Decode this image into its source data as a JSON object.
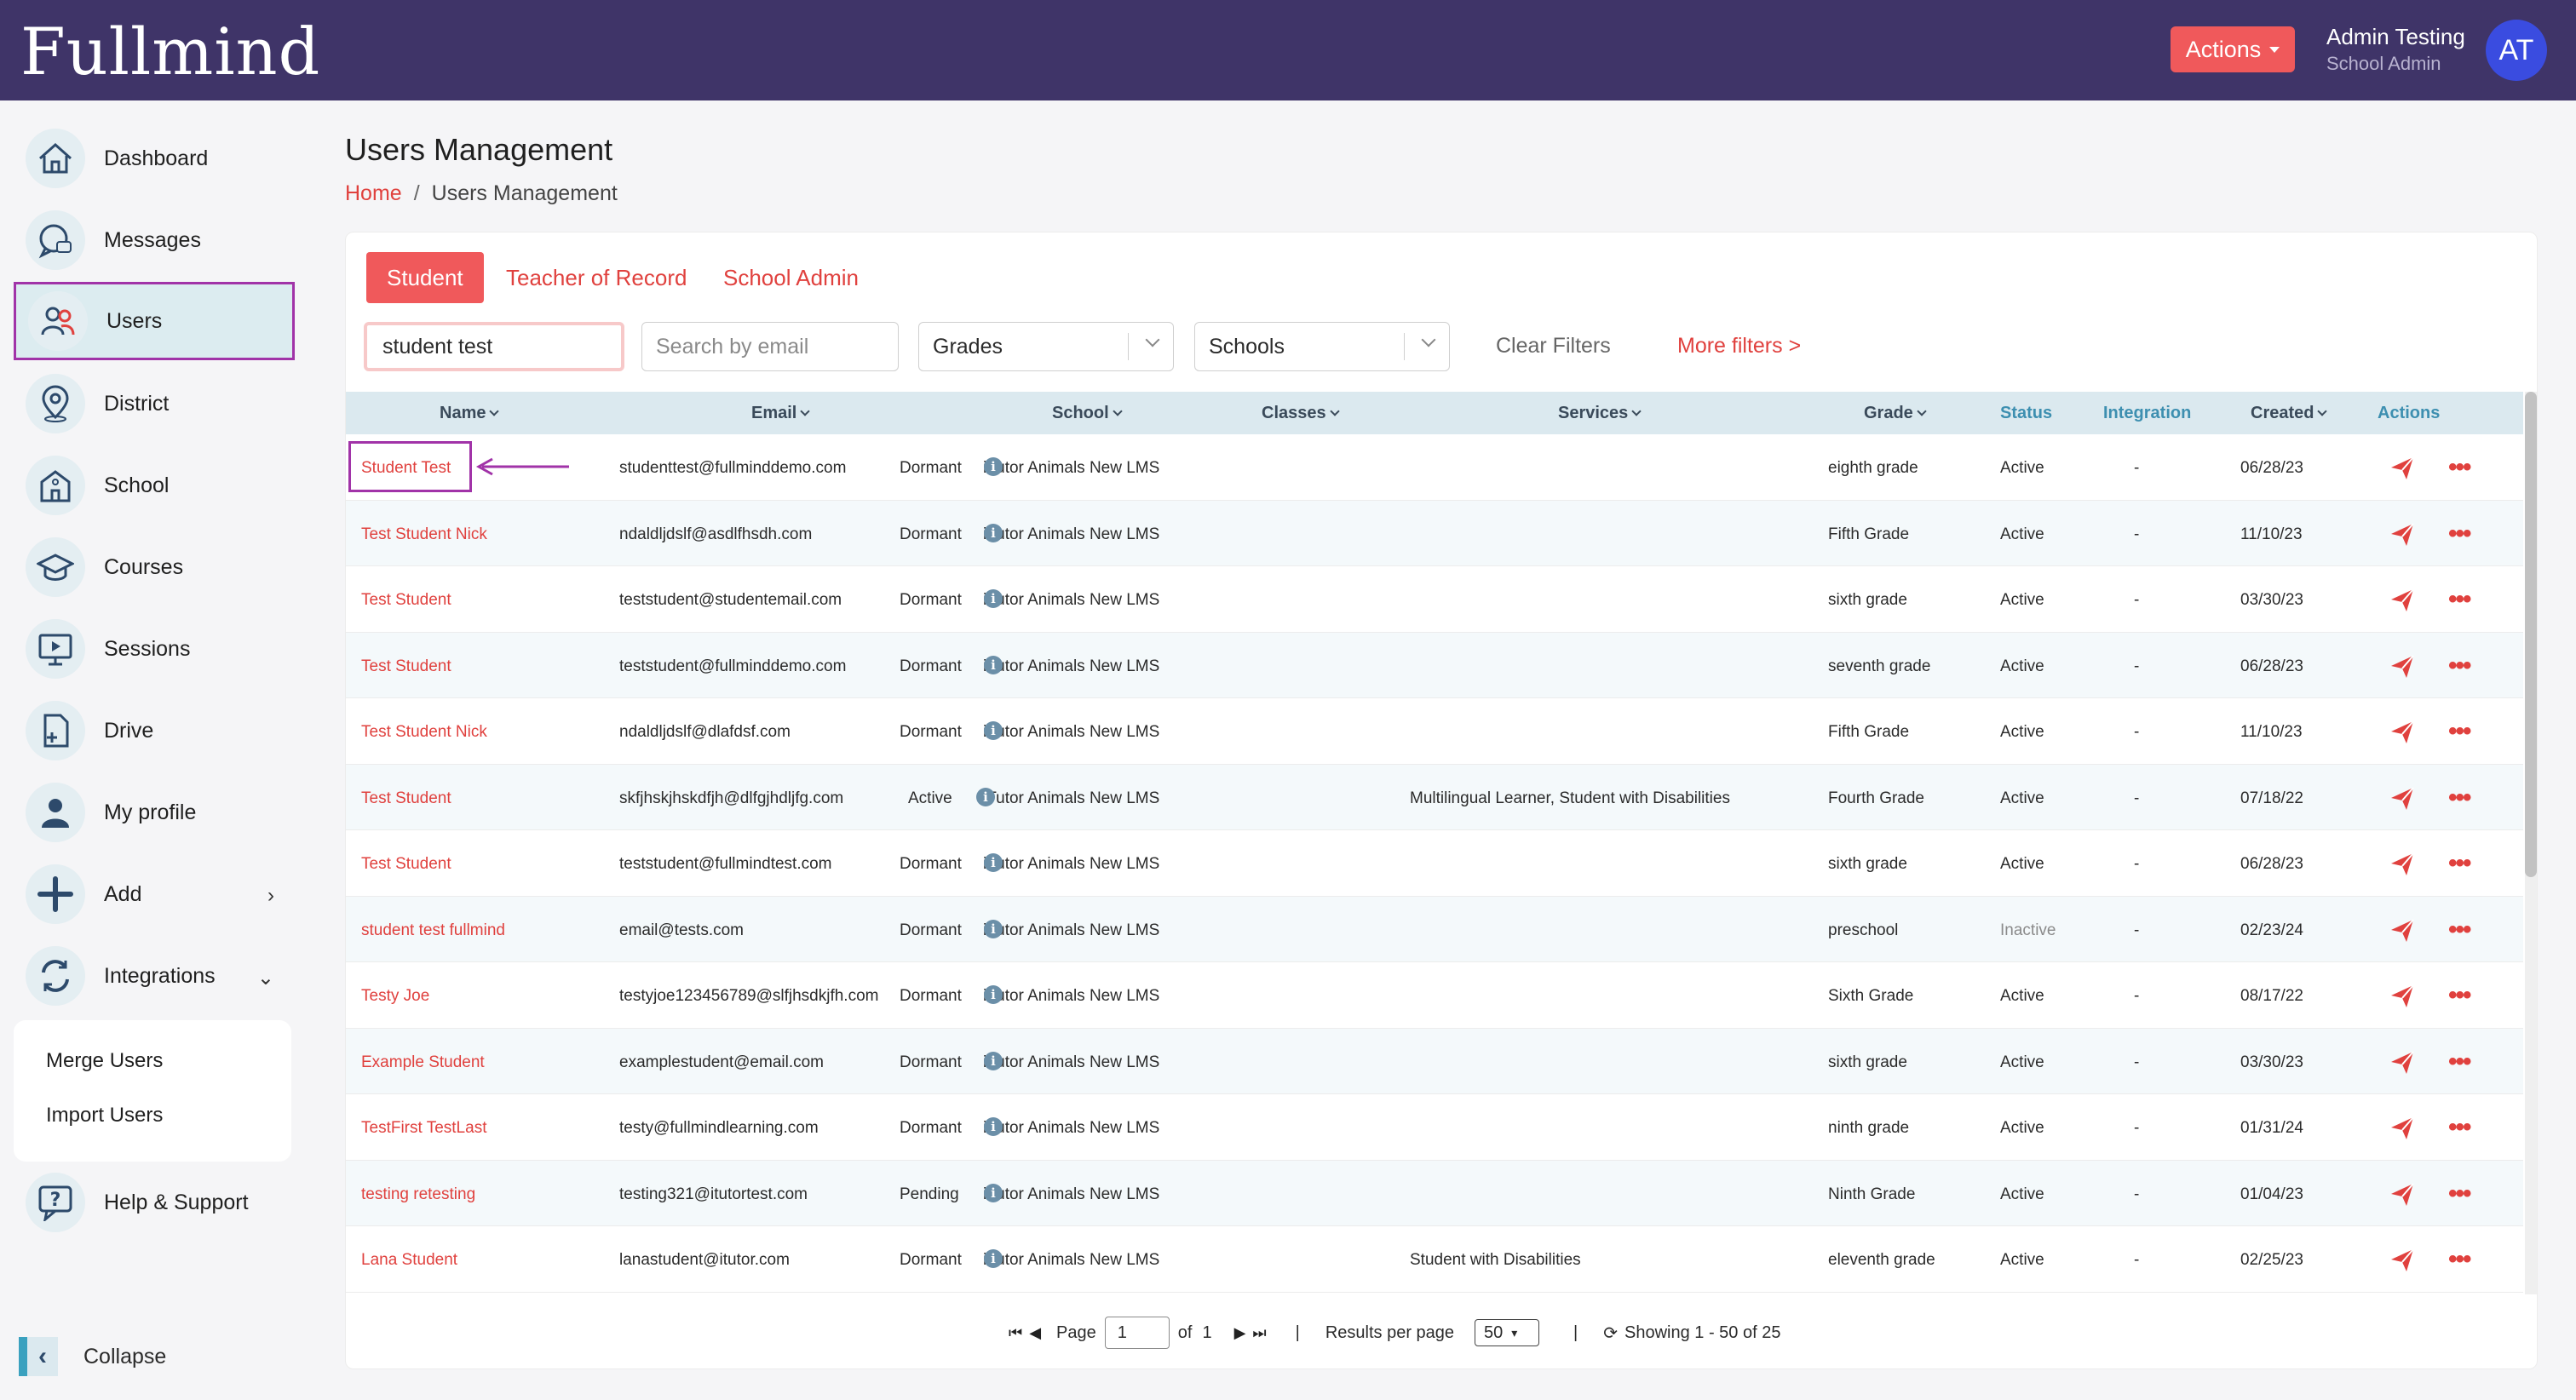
{
  "header": {
    "logo": "Fullmind",
    "actions_label": "Actions",
    "user_name": "Admin Testing",
    "user_role": "School Admin",
    "avatar_initials": "AT"
  },
  "sidebar": {
    "items": [
      {
        "label": "Dashboard",
        "icon": "home-icon"
      },
      {
        "label": "Messages",
        "icon": "chat-icon"
      },
      {
        "label": "Users",
        "icon": "users-icon"
      },
      {
        "label": "District",
        "icon": "location-pin-icon"
      },
      {
        "label": "School",
        "icon": "school-icon"
      },
      {
        "label": "Courses",
        "icon": "graduation-cap-icon"
      },
      {
        "label": "Sessions",
        "icon": "monitor-play-icon"
      },
      {
        "label": "Drive",
        "icon": "file-add-icon"
      },
      {
        "label": "My profile",
        "icon": "person-icon"
      },
      {
        "label": "Add",
        "icon": "plus-icon"
      },
      {
        "label": "Integrations",
        "icon": "sync-icon"
      }
    ],
    "submenu": [
      "Merge Users",
      "Import Users"
    ],
    "help_label": "Help & Support",
    "collapse_label": "Collapse"
  },
  "main": {
    "title": "Users Management",
    "breadcrumb_home": "Home",
    "breadcrumb_sep": "/",
    "breadcrumb_current": "Users Management",
    "tabs": [
      "Student",
      "Teacher of Record",
      "School Admin"
    ],
    "filters": {
      "name_value": "student test",
      "email_placeholder": "Search by email",
      "grades_label": "Grades",
      "schools_label": "Schools",
      "clear_label": "Clear Filters",
      "more_label": "More filters >"
    },
    "columns": [
      "Name",
      "Email",
      "School",
      "Classes",
      "Services",
      "Grade",
      "Status",
      "Integration",
      "Created",
      "Actions"
    ],
    "rows": [
      {
        "name": "Student Test",
        "email": "studenttest@fullminddemo.com",
        "school": "iTutor Animals New LMS",
        "classes": "Dormant",
        "services": "",
        "grade": "eighth grade",
        "status": "Active",
        "integration": "-",
        "created": "06/28/23"
      },
      {
        "name": "Test Student Nick",
        "email": "ndaldljdslf@asdlfhsdh.com",
        "school": "iTutor Animals New LMS",
        "classes": "Dormant",
        "services": "",
        "grade": "Fifth Grade",
        "status": "Active",
        "integration": "-",
        "created": "11/10/23"
      },
      {
        "name": "Test Student",
        "email": "teststudent@studentemail.com",
        "school": "iTutor Animals New LMS",
        "classes": "Dormant",
        "services": "",
        "grade": "sixth grade",
        "status": "Active",
        "integration": "-",
        "created": "03/30/23"
      },
      {
        "name": "Test Student",
        "email": "teststudent@fullminddemo.com",
        "school": "iTutor Animals New LMS",
        "classes": "Dormant",
        "services": "",
        "grade": "seventh grade",
        "status": "Active",
        "integration": "-",
        "created": "06/28/23"
      },
      {
        "name": "Test Student Nick",
        "email": "ndaldljdslf@dlafdsf.com",
        "school": "iTutor Animals New LMS",
        "classes": "Dormant",
        "services": "",
        "grade": "Fifth Grade",
        "status": "Active",
        "integration": "-",
        "created": "11/10/23"
      },
      {
        "name": "Test Student",
        "email": "skfjhskjhskdfjh@dlfgjhdljfg.com",
        "school": "iTutor Animals New LMS",
        "classes": "Active",
        "services": "Multilingual Learner, Student with Disabilities",
        "grade": "Fourth Grade",
        "status": "Active",
        "integration": "-",
        "created": "07/18/22"
      },
      {
        "name": "Test Student",
        "email": "teststudent@fullmindtest.com",
        "school": "iTutor Animals New LMS",
        "classes": "Dormant",
        "services": "",
        "grade": "sixth grade",
        "status": "Active",
        "integration": "-",
        "created": "06/28/23"
      },
      {
        "name": "student test fullmind",
        "email": "email@tests.com",
        "school": "iTutor Animals New LMS",
        "classes": "Dormant",
        "services": "",
        "grade": "preschool",
        "status": "Inactive",
        "integration": "-",
        "created": "02/23/24"
      },
      {
        "name": "Testy Joe",
        "email": "testyjoe123456789@slfjhsdkjfh.com",
        "school": "iTutor Animals New LMS",
        "classes": "Dormant",
        "services": "",
        "grade": "Sixth Grade",
        "status": "Active",
        "integration": "-",
        "created": "08/17/22"
      },
      {
        "name": "Example Student",
        "email": "examplestudent@email.com",
        "school": "iTutor Animals New LMS",
        "classes": "Dormant",
        "services": "",
        "grade": "sixth grade",
        "status": "Active",
        "integration": "-",
        "created": "03/30/23"
      },
      {
        "name": "TestFirst TestLast",
        "email": "testy@fullmindlearning.com",
        "school": "iTutor Animals New LMS",
        "classes": "Dormant",
        "services": "",
        "grade": "ninth grade",
        "status": "Active",
        "integration": "-",
        "created": "01/31/24"
      },
      {
        "name": "testing retesting",
        "email": "testing321@itutortest.com",
        "school": "iTutor Animals New LMS",
        "classes": "Pending",
        "services": "",
        "grade": "Ninth Grade",
        "status": "Active",
        "integration": "-",
        "created": "01/04/23"
      },
      {
        "name": "Lana Student",
        "email": "lanastudent@itutor.com",
        "school": "iTutor Animals New LMS",
        "classes": "Dormant",
        "services": "Student with Disabilities",
        "grade": "eleventh grade",
        "status": "Active",
        "integration": "-",
        "created": "02/25/23"
      }
    ],
    "pagination": {
      "page_label": "Page",
      "page_value": "1",
      "of_label": "of",
      "total_pages": "1",
      "results_label": "Results per page",
      "per_page": "50",
      "showing": "Showing 1 - 50 of 25"
    }
  },
  "colors": {
    "header_bg": "#3f3468",
    "accent": "#f0595b",
    "link": "#e0413e",
    "highlight": "#a133a8",
    "table_header": "#dbe9ef"
  }
}
